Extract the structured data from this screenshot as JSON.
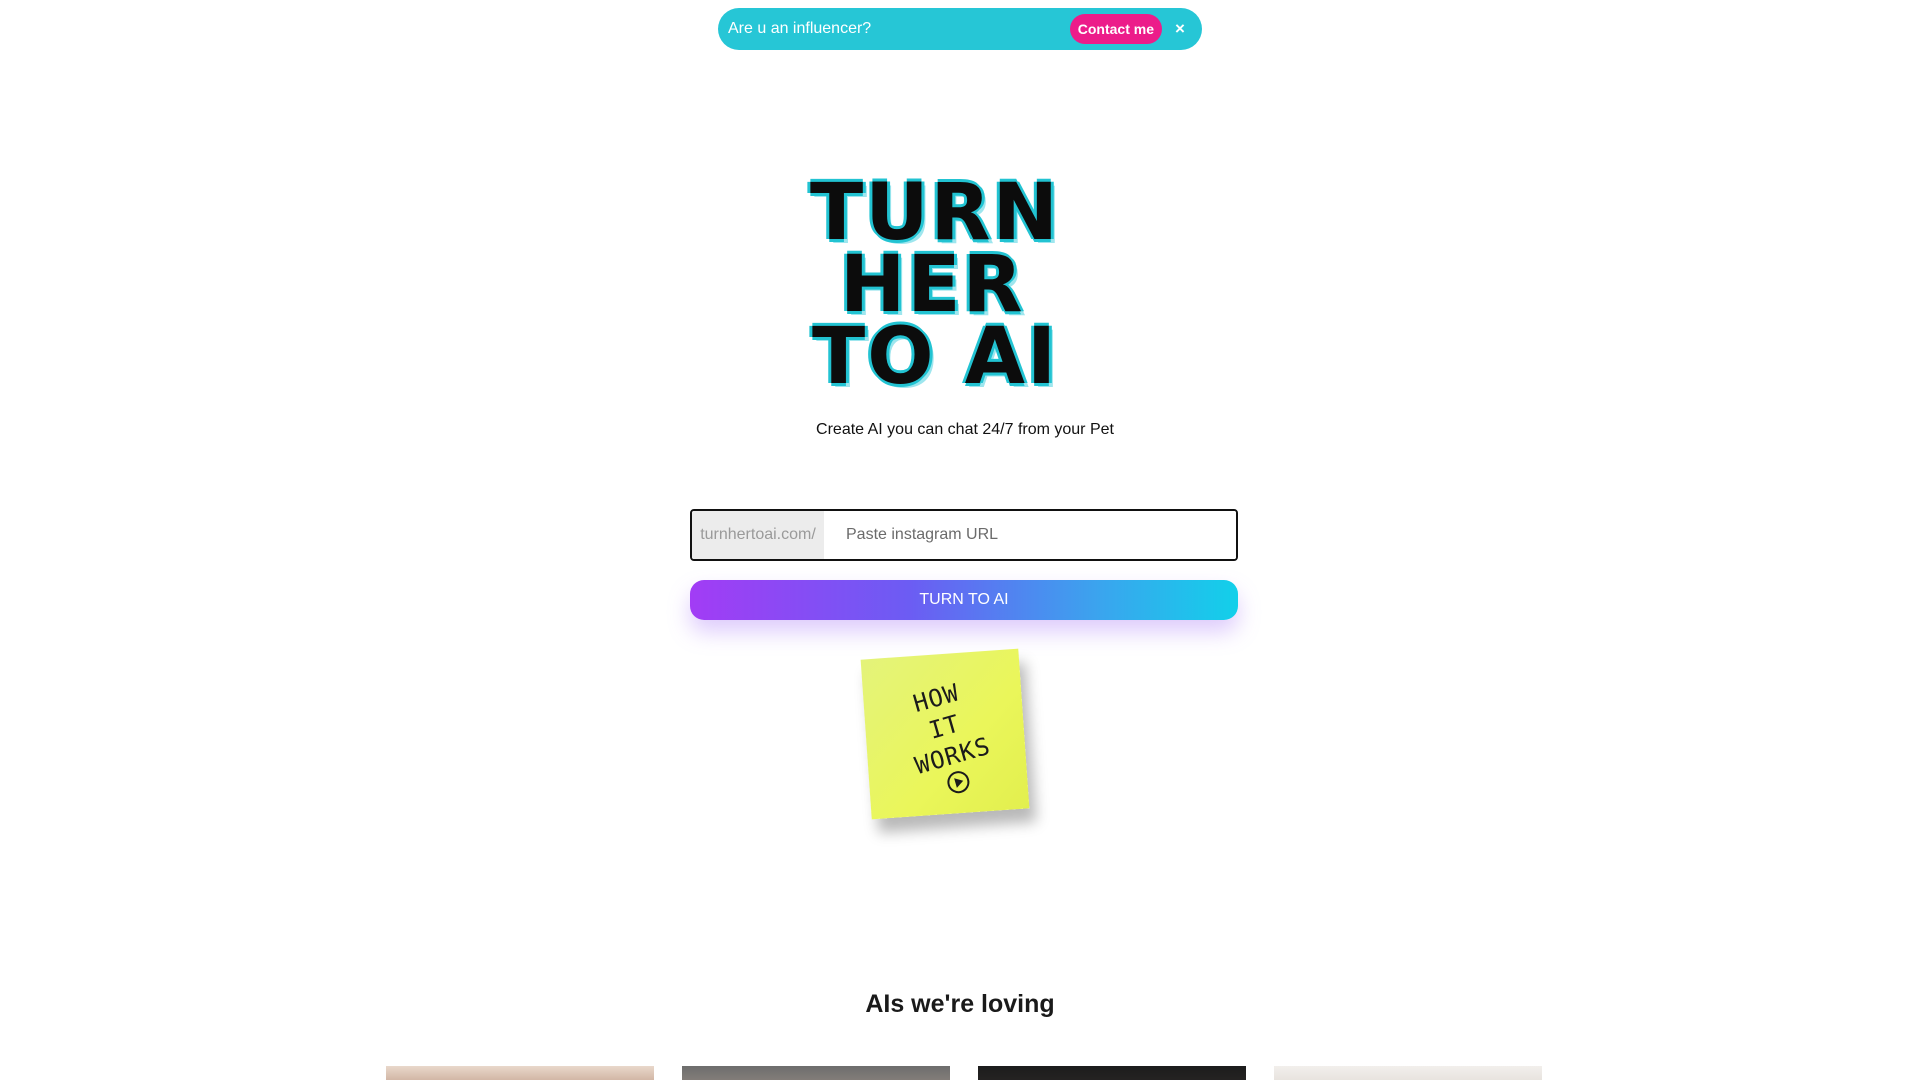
{
  "banner": {
    "text": "Are u an influencer?",
    "contact_label": "Contact me",
    "close_label": "×",
    "bg_color": "#26c6d6",
    "button_color": "#ec1c8a"
  },
  "logo": {
    "line1": "TURN",
    "line2": "HER",
    "line3": "TO AI"
  },
  "hero": {
    "tagline": "Create AI you can chat 24/7 from your Pet"
  },
  "url_form": {
    "prefix": "turnhertoai.com/",
    "value": "",
    "placeholder": "Paste instagram URL",
    "submit_label": "TURN TO AI"
  },
  "how_it_works": {
    "label": "HOW IT WORKS",
    "line1": "HOW",
    "line2": "IT",
    "line3": "WORKS",
    "icon": "play-icon"
  },
  "featured": {
    "title": "AIs we're loving",
    "cards": [
      {
        "name": "card-1"
      },
      {
        "name": "card-2"
      },
      {
        "name": "card-3"
      },
      {
        "name": "card-4"
      }
    ]
  },
  "colors": {
    "cta_gradient_start": "#a23cf5",
    "cta_gradient_end": "#12d0ea",
    "sticky_note": "#eaf65a"
  }
}
